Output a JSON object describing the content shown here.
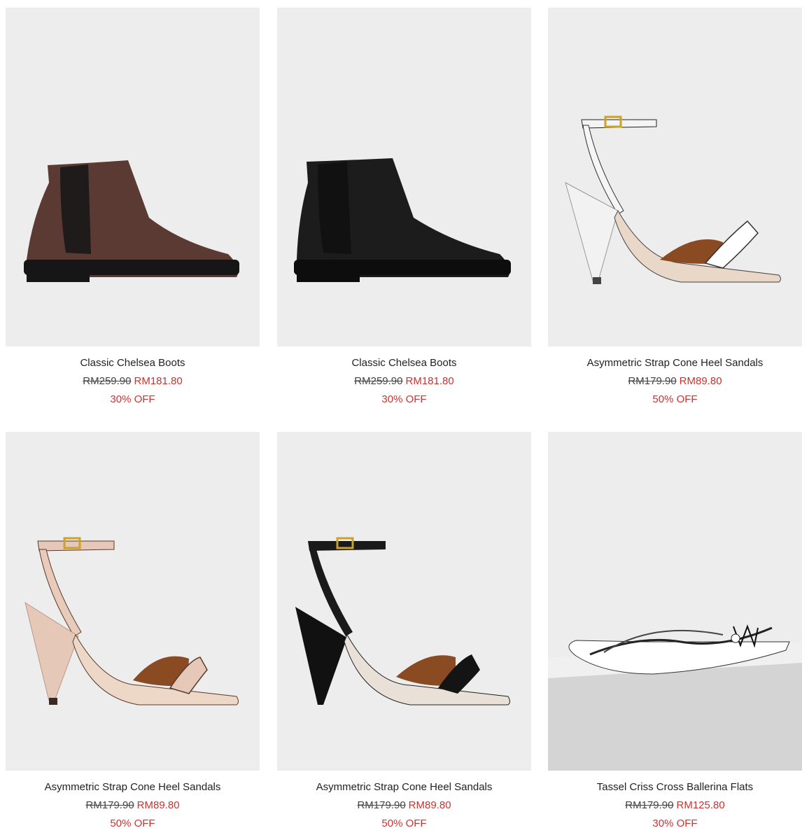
{
  "products": [
    {
      "name": "Classic Chelsea Boots",
      "original_price": "RM259.90",
      "sale_price": "RM181.80",
      "discount": "30% OFF",
      "image": "brown-chelsea-boot"
    },
    {
      "name": "Classic Chelsea Boots",
      "original_price": "RM259.90",
      "sale_price": "RM181.80",
      "discount": "30% OFF",
      "image": "black-chelsea-boot"
    },
    {
      "name": "Asymmetric Strap Cone Heel Sandals",
      "original_price": "RM179.90",
      "sale_price": "RM89.80",
      "discount": "50% OFF",
      "image": "white-cone-heel-sandal"
    },
    {
      "name": "Asymmetric Strap Cone Heel Sandals",
      "original_price": "RM179.90",
      "sale_price": "RM89.80",
      "discount": "50% OFF",
      "image": "nude-cone-heel-sandal"
    },
    {
      "name": "Asymmetric Strap Cone Heel Sandals",
      "original_price": "RM179.90",
      "sale_price": "RM89.80",
      "discount": "50% OFF",
      "image": "black-cone-heel-sandal"
    },
    {
      "name": "Tassel Criss Cross Ballerina Flats",
      "original_price": "RM179.90",
      "sale_price": "RM125.80",
      "discount": "30% OFF",
      "image": "white-tassel-flat"
    }
  ],
  "colors": {
    "sale": "#d0312d",
    "image_bg": "#ededee"
  }
}
